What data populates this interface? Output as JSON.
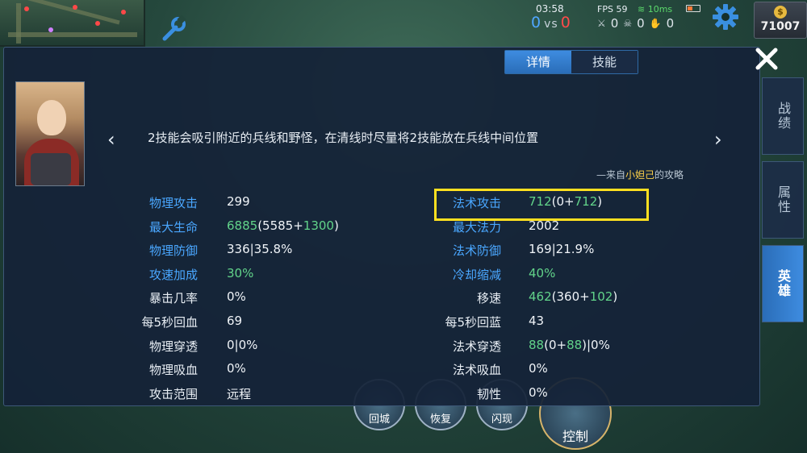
{
  "hud": {
    "time": "03:58",
    "score_blue": "0",
    "vs": "vs",
    "score_red": "0",
    "fps": "FPS 59",
    "ping": "10ms",
    "kills": "0",
    "deaths": "0",
    "assists": "0",
    "gold": "71007",
    "gold_symbol": "$"
  },
  "tabs": [
    {
      "label": "详情",
      "active": true
    },
    {
      "label": "技能",
      "active": false
    }
  ],
  "tip": {
    "text": "2技能会吸引附近的兵线和野怪，在清线时尽量将2技能放在兵线中间位置",
    "source_prefix": "—来自",
    "author": "小妲己",
    "source_suffix": "的攻略"
  },
  "stats_left": [
    {
      "label": "物理攻击",
      "value": "299",
      "highlight": true
    },
    {
      "label": "最大生命",
      "value_parts": [
        {
          "t": "6885",
          "g": true
        },
        {
          "t": "(5585+",
          "g": false
        },
        {
          "t": "1300",
          "g": true
        },
        {
          "t": ")",
          "g": false
        }
      ],
      "highlight": true
    },
    {
      "label": "物理防御",
      "value": "336|35.8%",
      "highlight": true
    },
    {
      "label": "攻速加成",
      "value_parts": [
        {
          "t": "30%",
          "g": true
        }
      ],
      "highlight": true
    },
    {
      "label": "暴击几率",
      "value": "0%",
      "highlight": false
    },
    {
      "label": "每5秒回血",
      "value": "69",
      "highlight": false
    },
    {
      "label": "物理穿透",
      "value": "0|0%",
      "highlight": false
    },
    {
      "label": "物理吸血",
      "value": "0%",
      "highlight": false
    },
    {
      "label": "攻击范围",
      "value": "远程",
      "highlight": false
    }
  ],
  "stats_right": [
    {
      "label": "法术攻击",
      "value_parts": [
        {
          "t": "712",
          "g": true
        },
        {
          "t": "(0+",
          "g": false
        },
        {
          "t": "712",
          "g": true
        },
        {
          "t": ")",
          "g": false
        }
      ],
      "highlight": true
    },
    {
      "label": "最大法力",
      "value": "2002",
      "highlight": true
    },
    {
      "label": "法术防御",
      "value": "169|21.9%",
      "highlight": true
    },
    {
      "label": "冷却缩减",
      "value_parts": [
        {
          "t": "40%",
          "g": true
        }
      ],
      "highlight": true
    },
    {
      "label": "移速",
      "value_parts": [
        {
          "t": "462",
          "g": true
        },
        {
          "t": "(360+",
          "g": false
        },
        {
          "t": "102",
          "g": true
        },
        {
          "t": ")",
          "g": false
        }
      ],
      "highlight": false
    },
    {
      "label": "每5秒回蓝",
      "value": "43",
      "highlight": false
    },
    {
      "label": "法术穿透",
      "value_parts": [
        {
          "t": "88",
          "g": true
        },
        {
          "t": "(0+",
          "g": false
        },
        {
          "t": "88",
          "g": true
        },
        {
          "t": ")|0%",
          "g": false
        }
      ],
      "highlight": false
    },
    {
      "label": "法术吸血",
      "value": "0%",
      "highlight": false
    },
    {
      "label": "韧性",
      "value": "0%",
      "highlight": false
    }
  ],
  "side_tabs": [
    {
      "label": "战绩",
      "active": false
    },
    {
      "label": "属性",
      "active": false
    },
    {
      "label": "英雄",
      "active": true
    }
  ],
  "skills": [
    {
      "label": "回城"
    },
    {
      "label": "恢复"
    },
    {
      "label": "闪现"
    },
    {
      "label": "控制"
    }
  ],
  "colors": {
    "highlight_label": "#4aa7ff",
    "green_value": "#62d48a",
    "annotation_box": "#ffe020",
    "tab_active": "#2a6db8"
  }
}
